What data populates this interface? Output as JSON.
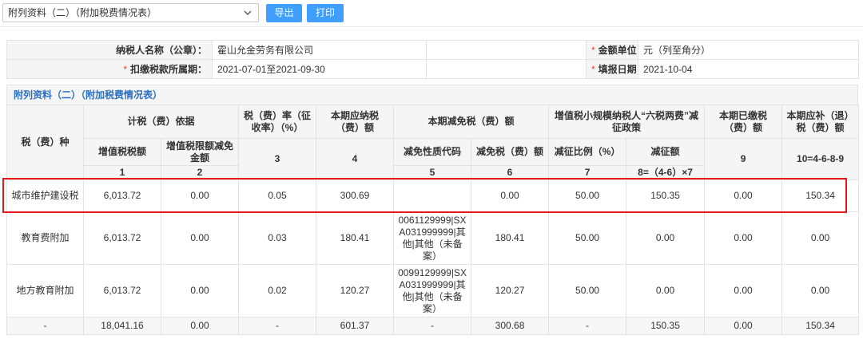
{
  "toolbar": {
    "report_select": "附列资料（二）（附加税费情况表）",
    "export_label": "导出",
    "print_label": "打印"
  },
  "info": {
    "taxpayer_label": "纳税人名称（公章）：",
    "taxpayer_value": "霍山允金劳务有限公司",
    "unit_label": "金额单位：",
    "unit_value": "元（列至角分）",
    "period_label": "扣缴税款所属期：",
    "period_value": "2021-07-01至2021-09-30",
    "date_label": "填报日期：",
    "date_value": "2021-10-04",
    "required_mark": "*"
  },
  "section_title": "附列资料（二）（附加税费情况表）",
  "table": {
    "h_tax_type": "税（费）种",
    "h_basis": "计税（费）依据",
    "h_rate": "税（费）率（征收率）（%）",
    "h_payable": "本期应纳税（费）额",
    "h_relief": "本期减免税（费）额",
    "h_small": "增值税小规模纳税人“六税两费”减征政策",
    "h_paid": "本期已缴税（费）额",
    "h_refund": "本期应补（退）税（费）额",
    "h_vat": "增值税税额",
    "h_vat_limit": "增值税限额减免金额",
    "h_relief_code": "减免性质代码",
    "h_relief_amt": "减免税（费）额",
    "h_ratio": "减征比例（%）",
    "h_reduce_amt": "减征额",
    "n1": "1",
    "n2": "2",
    "n3": "3",
    "n4": "4",
    "n5": "5",
    "n6": "6",
    "n7": "7",
    "n8": "8=（4-6）×7",
    "n9": "9",
    "n10": "10=4-6-8-9",
    "rows": [
      {
        "name": "城市维护建设税",
        "c1": "6,013.72",
        "c2": "0.00",
        "c3": "0.05",
        "c4": "300.69",
        "c5": "",
        "c6": "0.00",
        "c7": "50.00",
        "c8": "150.35",
        "c9": "0.00",
        "c10": "150.34"
      },
      {
        "name": "教育费附加",
        "c1": "6,013.72",
        "c2": "0.00",
        "c3": "0.03",
        "c4": "180.41",
        "c5": "0061129999|SXA031999999|其他|其他（未备案）",
        "c6": "180.41",
        "c7": "50.00",
        "c8": "0.00",
        "c9": "0.00",
        "c10": "0.00"
      },
      {
        "name": "地方教育附加",
        "c1": "6,013.72",
        "c2": "0.00",
        "c3": "0.02",
        "c4": "120.27",
        "c5": "0099129999|SXA031999999|其他|其他（未备案）",
        "c6": "120.27",
        "c7": "50.00",
        "c8": "0.00",
        "c9": "0.00",
        "c10": "0.00"
      }
    ],
    "total": {
      "name": "-",
      "c1": "18,041.16",
      "c2": "0.00",
      "c3": "-",
      "c4": "601.37",
      "c5": "-",
      "c6": "300.68",
      "c7": "-",
      "c8": "150.35",
      "c9": "0.00",
      "c10": "150.34"
    }
  },
  "colors": {
    "accent": "#409eff",
    "section_title": "#2a6fc1",
    "highlight": "#e5191b",
    "required": "#e64340"
  }
}
